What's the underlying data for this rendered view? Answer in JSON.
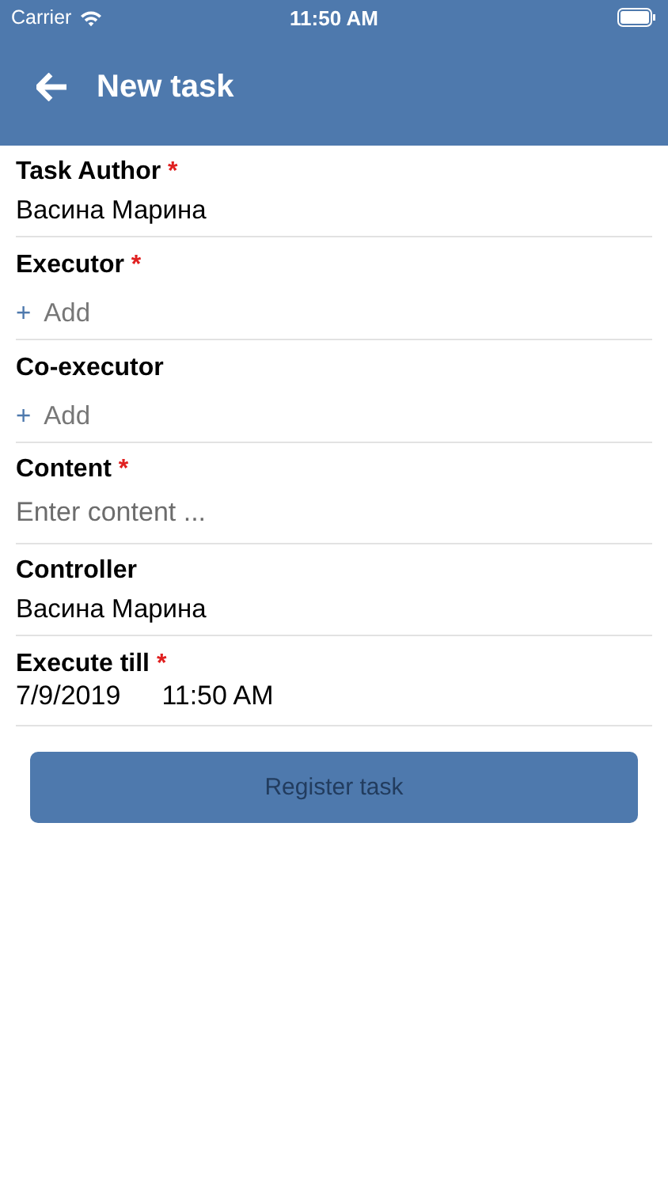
{
  "status_bar": {
    "carrier": "Carrier",
    "time": "11:50 AM"
  },
  "header": {
    "title": "New task"
  },
  "fields": [
    {
      "kind": "text",
      "label": "Task Author",
      "required_mark": "*",
      "value": "Васина Марина"
    },
    {
      "kind": "add",
      "label": "Executor",
      "required_mark": "*",
      "add_sign": "+",
      "add_label": "Add"
    },
    {
      "kind": "add",
      "label": "Co-executor",
      "add_sign": "+",
      "add_label": "Add"
    },
    {
      "kind": "input",
      "label": "Content",
      "required_mark": "*",
      "placeholder": "Enter content ..."
    },
    {
      "kind": "text",
      "label": "Controller",
      "value": "Васина Марина"
    },
    {
      "kind": "datetime",
      "label": "Execute till",
      "required_mark": "*",
      "date": "7/9/2019",
      "time": "11:50 AM"
    }
  ],
  "submit": {
    "label": "Register task",
    "disabled": true
  }
}
